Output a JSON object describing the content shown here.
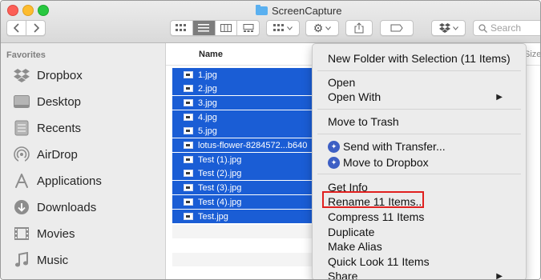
{
  "window": {
    "title": "ScreenCapture"
  },
  "toolbar": {
    "search_placeholder": "Search"
  },
  "sidebar": {
    "heading": "Favorites",
    "items": [
      {
        "label": "Dropbox",
        "icon": "dropbox-icon"
      },
      {
        "label": "Desktop",
        "icon": "desktop-icon"
      },
      {
        "label": "Recents",
        "icon": "recents-icon"
      },
      {
        "label": "AirDrop",
        "icon": "airdrop-icon"
      },
      {
        "label": "Applications",
        "icon": "applications-icon"
      },
      {
        "label": "Downloads",
        "icon": "downloads-icon"
      },
      {
        "label": "Movies",
        "icon": "movies-icon"
      },
      {
        "label": "Music",
        "icon": "music-icon"
      }
    ]
  },
  "list": {
    "name_header": "Name",
    "size_header": "Size",
    "files": [
      "1.jpg",
      "2.jpg",
      "3.jpg",
      "4.jpg",
      "5.jpg",
      "lotus-flower-8284572...b640",
      "Test (1).jpg",
      "Test (2).jpg",
      "Test (3).jpg",
      "Test (4).jpg",
      "Test.jpg"
    ]
  },
  "context_menu": {
    "new_folder": "New Folder with Selection (11 Items)",
    "open": "Open",
    "open_with": "Open With",
    "move_to_trash": "Move to Trash",
    "send_with_transfer": "Send with Transfer...",
    "move_to_dropbox": "Move to Dropbox",
    "get_info": "Get Info",
    "rename": "Rename 11 Items...",
    "compress": "Compress 11 Items",
    "duplicate": "Duplicate",
    "make_alias": "Make Alias",
    "quick_look": "Quick Look 11 Items",
    "share": "Share"
  },
  "colors": {
    "selection": "#1a5dd5",
    "highlight_box": "#e0201f"
  }
}
